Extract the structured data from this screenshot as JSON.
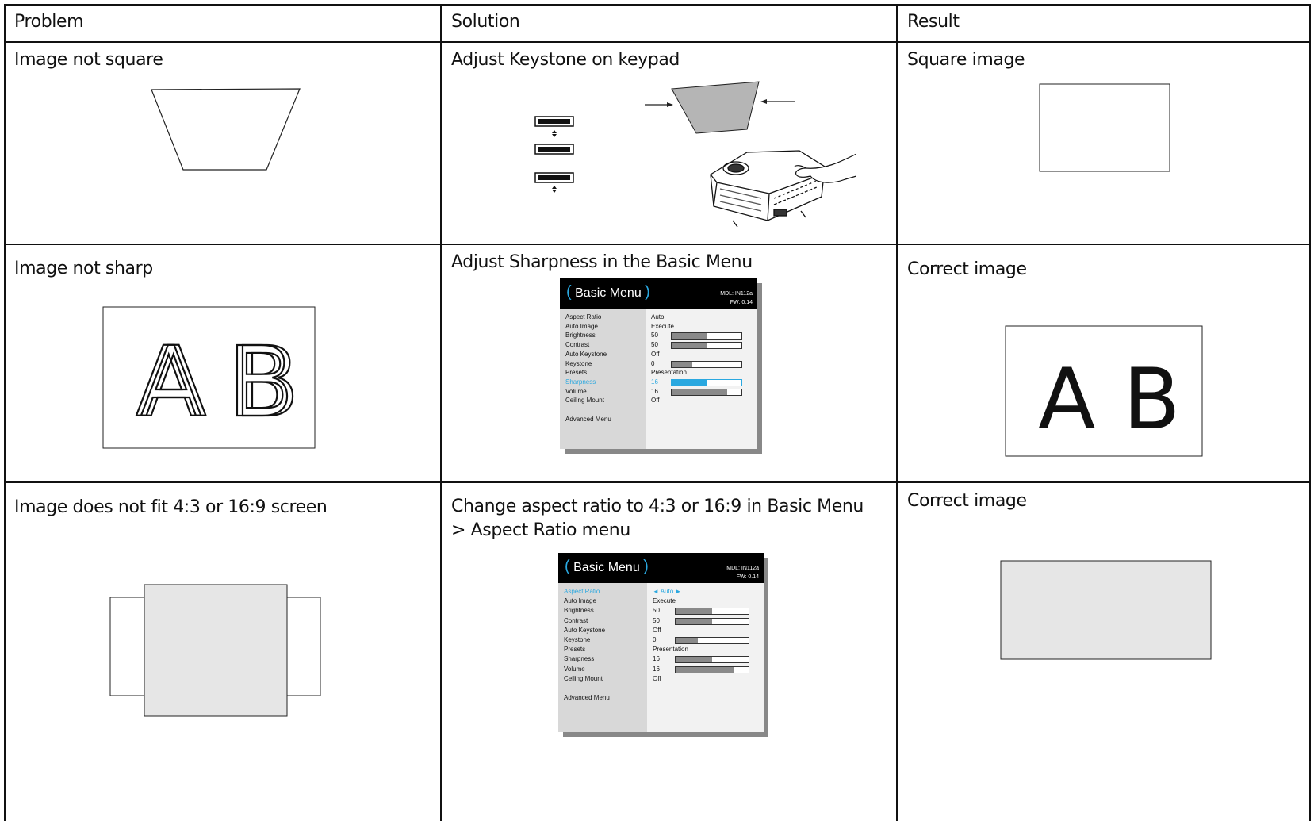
{
  "table": {
    "headers": {
      "problem": "Problem",
      "solution": "Solution",
      "result": "Result"
    },
    "rows": [
      {
        "problem": "Image not square",
        "solution": "Adjust Keystone on keypad",
        "result": "Square image"
      },
      {
        "problem": "Image not sharp",
        "solution": "Adjust Sharpness in the Basic Menu",
        "result": "Correct image"
      },
      {
        "problem": "Image does not fit 4:3 or 16:9 screen",
        "solution": "Change aspect ratio to 4:3 or 16:9 in Basic Menu > Aspect Ratio menu",
        "result": "Correct image"
      }
    ]
  },
  "sample_letters": {
    "a": "A",
    "b": "B"
  },
  "basic_menu_1": {
    "paren_open": "(",
    "title": "Basic Menu",
    "paren_close": ")",
    "mdl": "MDL: IN112a",
    "fw": "FW: 0.14",
    "items": [
      {
        "label": "Aspect Ratio",
        "value": "Auto"
      },
      {
        "label": "Auto Image",
        "value": "Execute"
      },
      {
        "label": "Brightness",
        "value": "50",
        "bar": 0.5
      },
      {
        "label": "Contrast",
        "value": "50",
        "bar": 0.5
      },
      {
        "label": "Auto Keystone",
        "value": "Off"
      },
      {
        "label": "Keystone",
        "value": "0",
        "bar": 0.3
      },
      {
        "label": "Presets",
        "value": "Presentation"
      },
      {
        "label": "Sharpness",
        "value": "16",
        "bar": 0.5,
        "highlight": true
      },
      {
        "label": "Volume",
        "value": "16",
        "bar": 0.8
      },
      {
        "label": "Ceiling Mount",
        "value": "Off"
      }
    ],
    "advanced": "Advanced Menu"
  },
  "basic_menu_2": {
    "paren_open": "(",
    "title": "Basic Menu",
    "paren_close": ")",
    "mdl": "MDL: IN112a",
    "fw": "FW: 0.14",
    "items": [
      {
        "label": "Aspect Ratio",
        "value": "◄ Auto ►",
        "highlight": true
      },
      {
        "label": "Auto Image",
        "value": "Execute"
      },
      {
        "label": "Brightness",
        "value": "50",
        "bar": 0.5
      },
      {
        "label": "Contrast",
        "value": "50",
        "bar": 0.5
      },
      {
        "label": "Auto Keystone",
        "value": "Off"
      },
      {
        "label": "Keystone",
        "value": "0",
        "bar": 0.3
      },
      {
        "label": "Presets",
        "value": "Presentation"
      },
      {
        "label": "Sharpness",
        "value": "16",
        "bar": 0.5
      },
      {
        "label": "Volume",
        "value": "16",
        "bar": 0.8
      },
      {
        "label": "Ceiling Mount",
        "value": "Off"
      }
    ],
    "advanced": "Advanced Menu"
  },
  "colors": {
    "highlight": "#2aa8e0",
    "panel_gray": "#e6e6e6",
    "line": "#111111"
  }
}
